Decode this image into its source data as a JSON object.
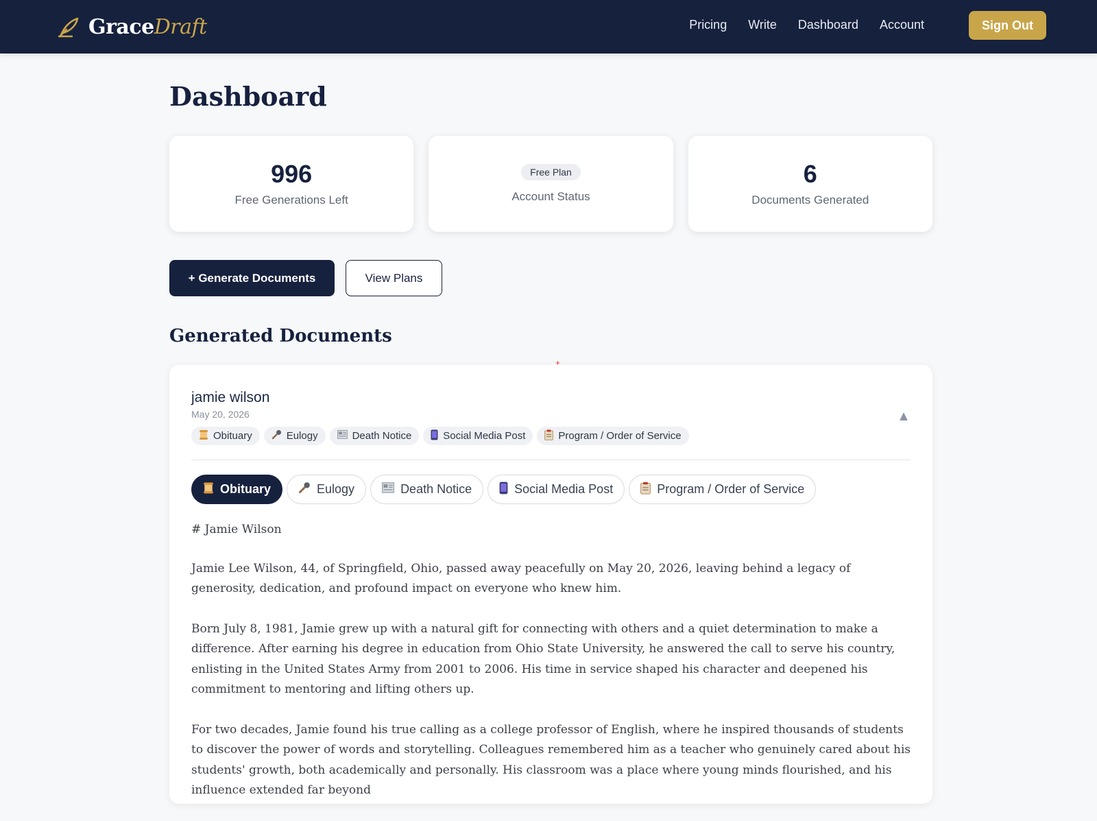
{
  "brand": {
    "part1": "Grace",
    "part2": "Draft"
  },
  "nav": {
    "links": [
      "Pricing",
      "Write",
      "Dashboard",
      "Account"
    ],
    "sign_out": "Sign Out"
  },
  "page": {
    "title": "Dashboard"
  },
  "stats": {
    "free_generations": {
      "value": "996",
      "label": "Free Generations Left"
    },
    "account": {
      "badge": "Free Plan",
      "label": "Account Status"
    },
    "documents": {
      "value": "6",
      "label": "Documents Generated"
    }
  },
  "actions": {
    "generate": "+ Generate Documents",
    "view_plans": "View Plans"
  },
  "section": {
    "title": "Generated Documents"
  },
  "marker": "+",
  "document": {
    "name": "jamie wilson",
    "date": "May 20, 2026",
    "toggle_icon": "▲",
    "tags": [
      {
        "icon": "scroll-icon",
        "label": "Obituary"
      },
      {
        "icon": "microphone-icon",
        "label": "Eulogy"
      },
      {
        "icon": "newspaper-icon",
        "label": "Death Notice"
      },
      {
        "icon": "phone-icon",
        "label": "Social Media Post"
      },
      {
        "icon": "clipboard-icon",
        "label": "Program / Order of Service"
      }
    ],
    "tabs": [
      {
        "icon": "scroll-icon",
        "label": "Obituary",
        "active": true
      },
      {
        "icon": "microphone-icon",
        "label": "Eulogy",
        "active": false
      },
      {
        "icon": "newspaper-icon",
        "label": "Death Notice",
        "active": false
      },
      {
        "icon": "phone-icon",
        "label": "Social Media Post",
        "active": false
      },
      {
        "icon": "clipboard-icon",
        "label": "Program / Order of Service",
        "active": false
      }
    ],
    "content": {
      "heading": "# Jamie Wilson",
      "paragraphs": [
        "Jamie Lee Wilson, 44, of Springfield, Ohio, passed away peacefully on May 20, 2026, leaving behind a legacy of generosity, dedication, and profound impact on everyone who knew him.",
        "Born July 8, 1981, Jamie grew up with a natural gift for connecting with others and a quiet determination to make a difference. After earning his degree in education from Ohio State University, he answered the call to serve his country, enlisting in the United States Army from 2001 to 2006. His time in service shaped his character and deepened his commitment to mentoring and lifting others up.",
        "For two decades, Jamie found his true calling as a college professor of English, where he inspired thousands of students to discover the power of words and storytelling. Colleagues remembered him as a teacher who genuinely cared about his students' growth, both academically and personally. His classroom was a place where young minds flourished, and his influence extended far beyond"
      ]
    }
  },
  "colors": {
    "navy": "#16213e",
    "gold": "#c9a54a",
    "background": "#f7f8fa"
  }
}
